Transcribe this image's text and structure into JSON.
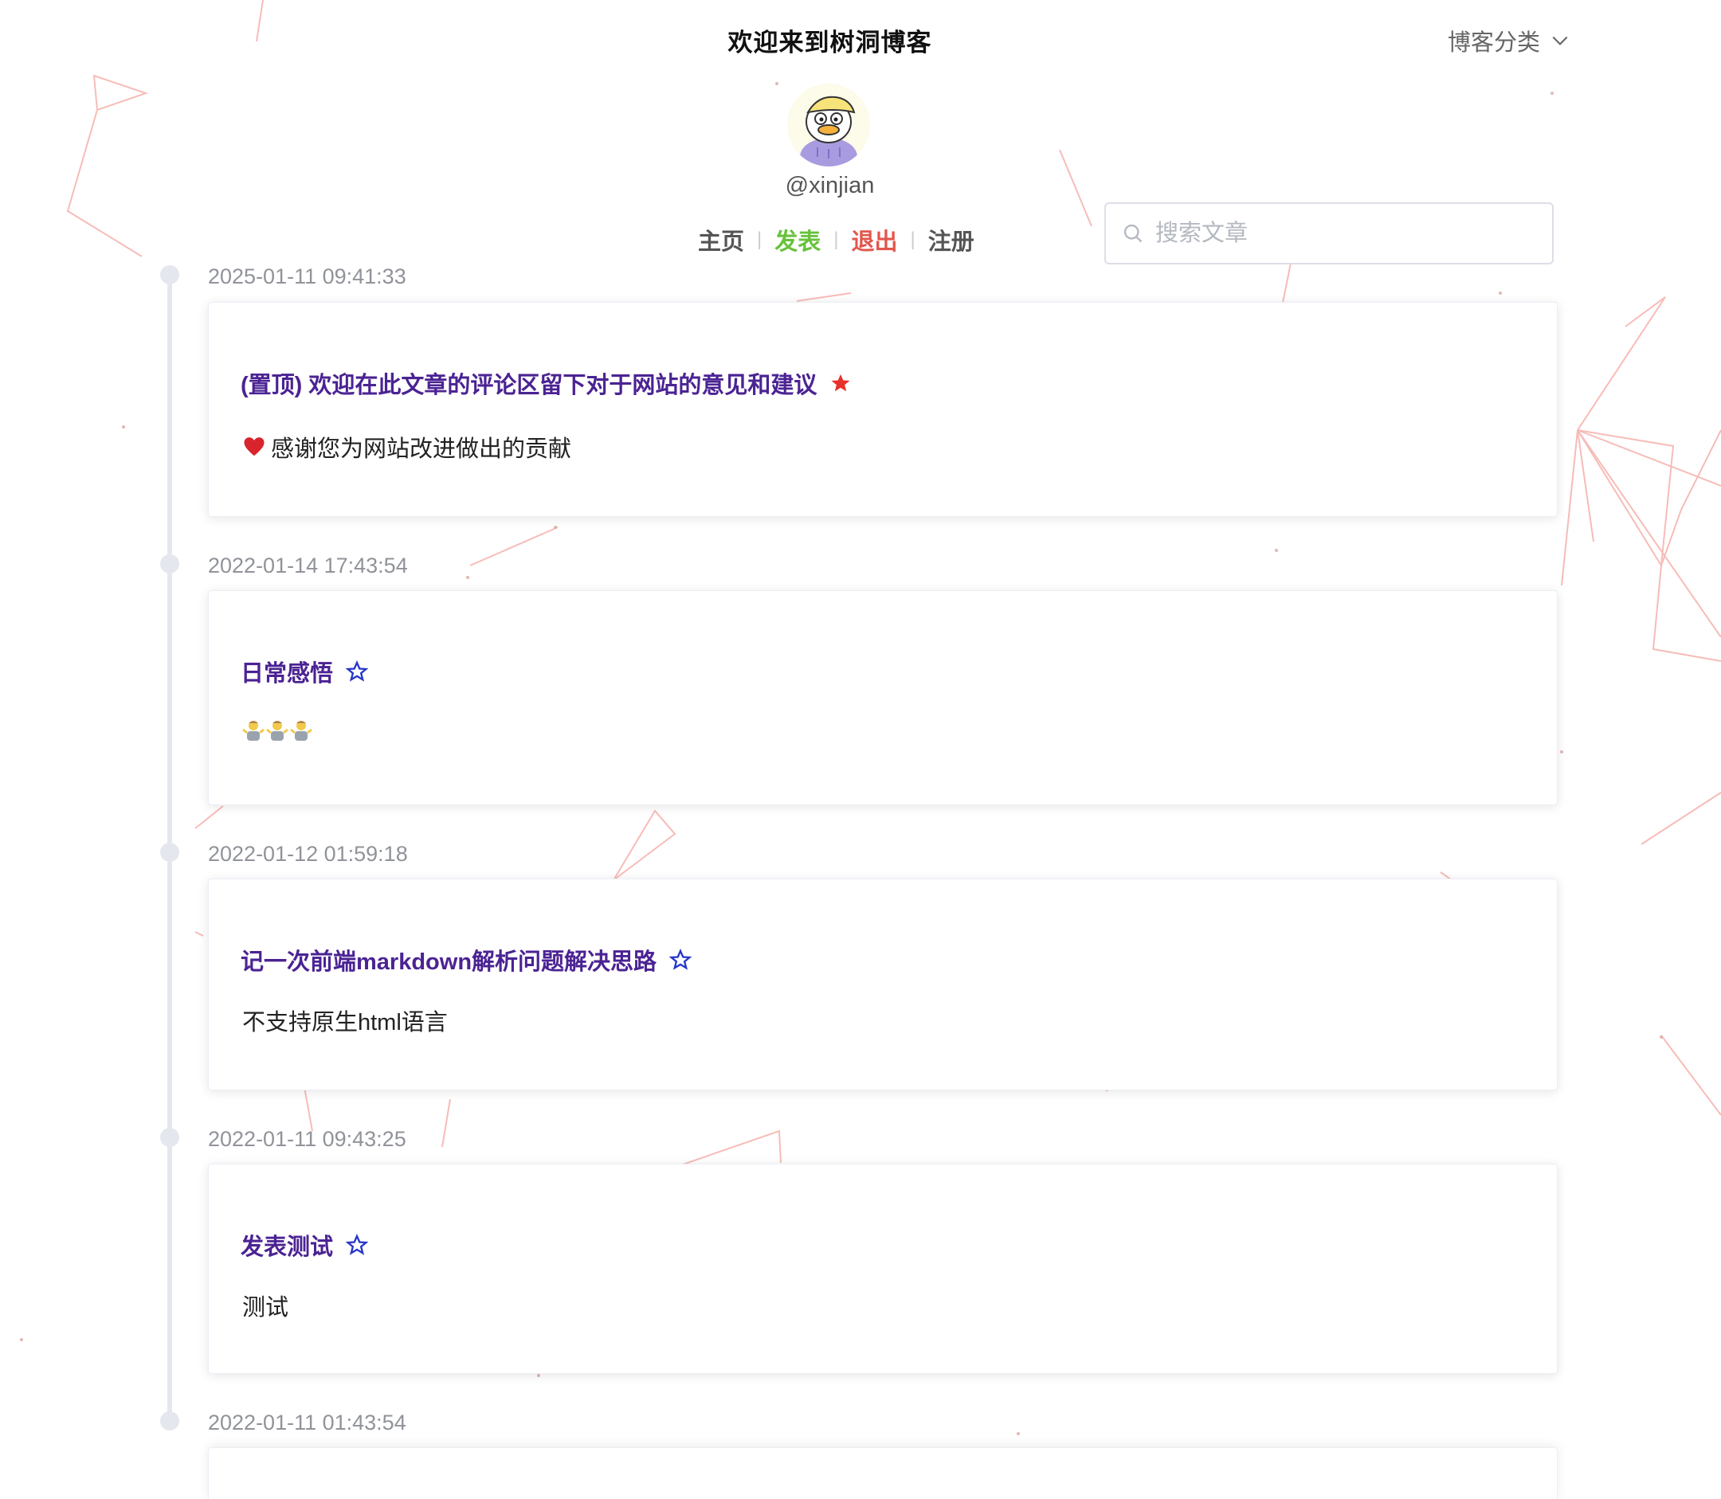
{
  "header": {
    "site_title": "欢迎来到树洞博客",
    "category_menu_label": "博客分类"
  },
  "profile": {
    "username": "@xinjian"
  },
  "nav": {
    "home": "主页",
    "publish": "发表",
    "logout": "退出",
    "register": "注册"
  },
  "search": {
    "placeholder": "搜索文章",
    "value": ""
  },
  "colors": {
    "title_purple": "#4b2393",
    "publish_green": "#67c23a",
    "logout_red": "#e2574c",
    "pinned_star_red": "#e8312a",
    "star_outline_blue": "#2636c9",
    "timeline_gray": "#e4e7ed",
    "background_network_pink": "#f4a6a0"
  },
  "posts": [
    {
      "timestamp": "2025-01-11 09:41:33",
      "title": "(置顶) 欢迎在此文章的评论区留下对于网站的意见和建议",
      "description": "感谢您为网站改进做出的贡献",
      "icon": "heart-icon",
      "star": "filled-star-icon"
    },
    {
      "timestamp": "2022-01-14 17:43:54",
      "title": "日常感悟",
      "description": "",
      "icon": "person-shrugging-emoji",
      "star": "outline-star-icon"
    },
    {
      "timestamp": "2022-01-12 01:59:18",
      "title": "记一次前端markdown解析问题解决思路",
      "description": "不支持原生html语言",
      "star": "outline-star-icon"
    },
    {
      "timestamp": "2022-01-11 09:43:25",
      "title": "发表测试",
      "description": "测试",
      "star": "outline-star-icon"
    },
    {
      "timestamp": "2022-01-11 01:43:54",
      "title": "",
      "description": "",
      "star": ""
    }
  ]
}
